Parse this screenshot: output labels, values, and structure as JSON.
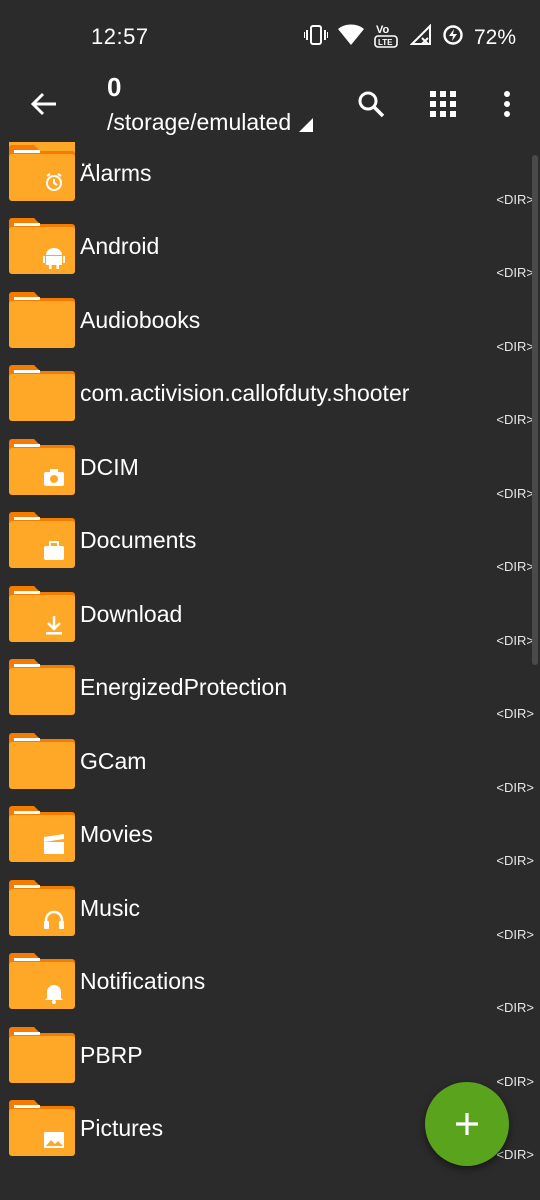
{
  "status_bar": {
    "time": "12:57",
    "battery": "72%",
    "icons": [
      "vibrate-icon",
      "wifi-icon",
      "volte-icon",
      "signal-icon",
      "battery-saver-icon"
    ]
  },
  "toolbar": {
    "title": "0",
    "path": "/storage/emulated",
    "back_icon": "arrow-back-icon",
    "search_icon": "search-icon",
    "grid_icon": "grid-view-icon",
    "more_icon": "more-vert-icon"
  },
  "files": [
    {
      "name": "..",
      "type": "parent",
      "tag": ""
    },
    {
      "name": "Alarms",
      "type": "alarm",
      "tag": "<DIR>"
    },
    {
      "name": "Android",
      "type": "android",
      "tag": "<DIR>"
    },
    {
      "name": "Audiobooks",
      "type": "plain",
      "tag": "<DIR>"
    },
    {
      "name": "com.activision.callofduty.shooter",
      "type": "plain",
      "tag": "<DIR>"
    },
    {
      "name": "DCIM",
      "type": "camera",
      "tag": "<DIR>"
    },
    {
      "name": "Documents",
      "type": "briefcase",
      "tag": "<DIR>"
    },
    {
      "name": "Download",
      "type": "download",
      "tag": "<DIR>"
    },
    {
      "name": "EnergizedProtection",
      "type": "plain",
      "tag": "<DIR>"
    },
    {
      "name": "GCam",
      "type": "plain",
      "tag": "<DIR>"
    },
    {
      "name": "Movies",
      "type": "movie",
      "tag": "<DIR>"
    },
    {
      "name": "Music",
      "type": "headphones",
      "tag": "<DIR>"
    },
    {
      "name": "Notifications",
      "type": "bell",
      "tag": "<DIR>"
    },
    {
      "name": "PBRP",
      "type": "plain",
      "tag": "<DIR>"
    },
    {
      "name": "Pictures",
      "type": "image",
      "tag": "<DIR>"
    }
  ],
  "fab": {
    "icon": "add-icon"
  },
  "colors": {
    "background": "#2b2b2b",
    "folder": "#ffa726",
    "folder_tab": "#f57c00",
    "fab": "#5aa31d",
    "up_arrow": "#6b9e1f"
  }
}
